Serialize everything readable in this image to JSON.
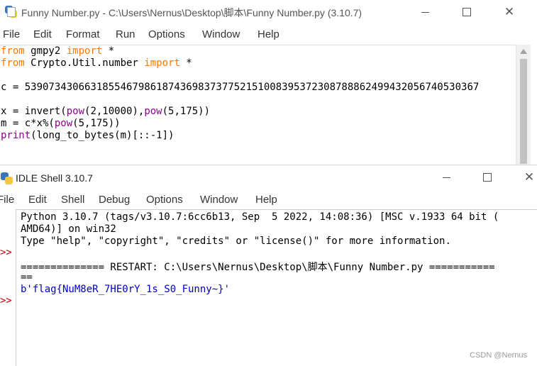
{
  "editor": {
    "title": "Funny Number.py - C:\\Users\\Nernus\\Desktop\\脚本\\Funny Number.py (3.10.7)",
    "controls": {
      "minimize": "—",
      "maximize": "☐",
      "close": "✕"
    },
    "menu": [
      "File",
      "Edit",
      "Format",
      "Run",
      "Options",
      "Window",
      "Help"
    ],
    "code": {
      "l1": {
        "kw1": "from",
        "mid": " gmpy2 ",
        "kw2": "import",
        "rest": " *"
      },
      "l2": {
        "kw1": "from",
        "mid": " Crypto.Util.number ",
        "kw2": "import",
        "rest": " *"
      },
      "l3": "c = 5390734306631855467986187436983737752151008395372308788862499432056740530367",
      "l4": {
        "a": "x = invert(",
        "f1": "pow",
        "b": "(2,10000),",
        "f2": "pow",
        "c": "(5,175))"
      },
      "l5": {
        "a": "m = c*x%(",
        "f1": "pow",
        "b": "(5,175))"
      },
      "l6": {
        "f1": "print",
        "b": "(long_to_bytes(m)[::-1])"
      }
    }
  },
  "shell": {
    "title": "IDLE Shell 3.10.7",
    "menu": [
      "File",
      "Edit",
      "Shell",
      "Debug",
      "Options",
      "Window",
      "Help"
    ],
    "prompts": [
      ">>",
      ">>"
    ],
    "lines": [
      "Python 3.10.7 (tags/v3.10.7:6cc6b13, Sep  5 2022, 14:08:36) [MSC v.1933 64 bit (",
      "AMD64)] on win32",
      "Type \"help\", \"copyright\", \"credits\" or \"license()\" for more information.",
      "============== RESTART: C:\\Users\\Nernus\\Desktop\\脚本\\Funny Number.py ===========",
      "==",
      "b'flag{NuM8eR_7HE0rY_1s_S0_Funny~}'"
    ],
    "watermark": "CSDN @Nernus"
  }
}
